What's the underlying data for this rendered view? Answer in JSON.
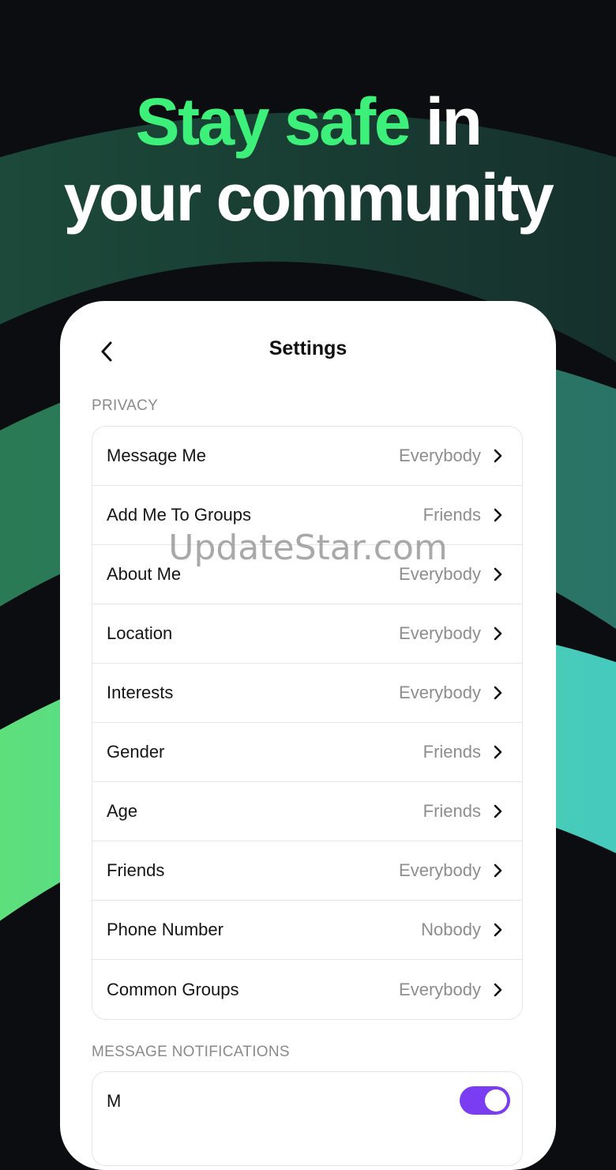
{
  "headline": {
    "accent": "Stay safe",
    "rest_line1": "in",
    "line2": "your community"
  },
  "colors": {
    "accent_green": "#3df07a",
    "toggle_purple": "#7b3df2",
    "background": "#0c0d10"
  },
  "settings": {
    "title": "Settings",
    "back_icon": "chevron-left-icon",
    "privacy_label": "PRIVACY",
    "privacy_items": [
      {
        "label": "Message Me",
        "value": "Everybody"
      },
      {
        "label": "Add Me To Groups",
        "value": "Friends"
      },
      {
        "label": "About Me",
        "value": "Everybody"
      },
      {
        "label": "Location",
        "value": "Everybody"
      },
      {
        "label": "Interests",
        "value": "Everybody"
      },
      {
        "label": "Gender",
        "value": "Friends"
      },
      {
        "label": "Age",
        "value": "Friends"
      },
      {
        "label": "Friends",
        "value": "Everybody"
      },
      {
        "label": "Phone Number",
        "value": "Nobody"
      },
      {
        "label": "Common Groups",
        "value": "Everybody"
      }
    ],
    "notifications_label": "MESSAGE NOTIFICATIONS",
    "notifications_toggle_on": true,
    "notifications_item_label": "M"
  },
  "watermark": "UpdateStar.com"
}
